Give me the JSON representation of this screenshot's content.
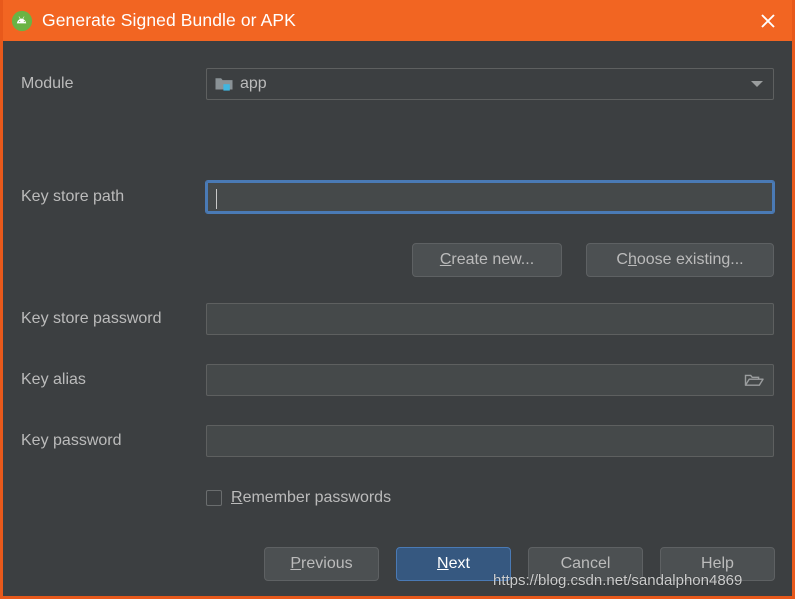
{
  "window": {
    "title": "Generate Signed Bundle or APK",
    "accent_color": "#f26522",
    "background_color": "#3c3f41",
    "app_icon": "android-studio-icon",
    "close_icon": "close-icon"
  },
  "form": {
    "module": {
      "label": "Module",
      "value": "app",
      "icon": "module-folder-icon",
      "dropdown_icon": "chevron-down-icon"
    },
    "key_store_path": {
      "label": "Key store path",
      "value": "",
      "focused": true
    },
    "key_store_password": {
      "label": "Key store password",
      "value": ""
    },
    "key_alias": {
      "label": "Key alias",
      "value": "",
      "browse_icon": "folder-open-icon"
    },
    "key_password": {
      "label": "Key password",
      "value": ""
    },
    "remember_passwords": {
      "label": "Remember passwords",
      "mnemonic": "R",
      "checked": false
    }
  },
  "keystore_actions": [
    {
      "name": "create-new",
      "mnemonic": "C",
      "rest": "reate new..."
    },
    {
      "name": "choose-existing",
      "pre": "C",
      "mnemonic": "h",
      "rest": "oose existing..."
    }
  ],
  "footer_buttons": [
    {
      "name": "previous",
      "mnemonic": "P",
      "rest": "revious",
      "default": false
    },
    {
      "name": "next",
      "mnemonic": "N",
      "rest": "ext",
      "default": true
    },
    {
      "name": "cancel",
      "label": "Cancel",
      "default": false
    },
    {
      "name": "help",
      "label": "Help",
      "default": false
    }
  ],
  "watermark": {
    "text": "https://blog.csdn.net/sandalphon4869"
  }
}
